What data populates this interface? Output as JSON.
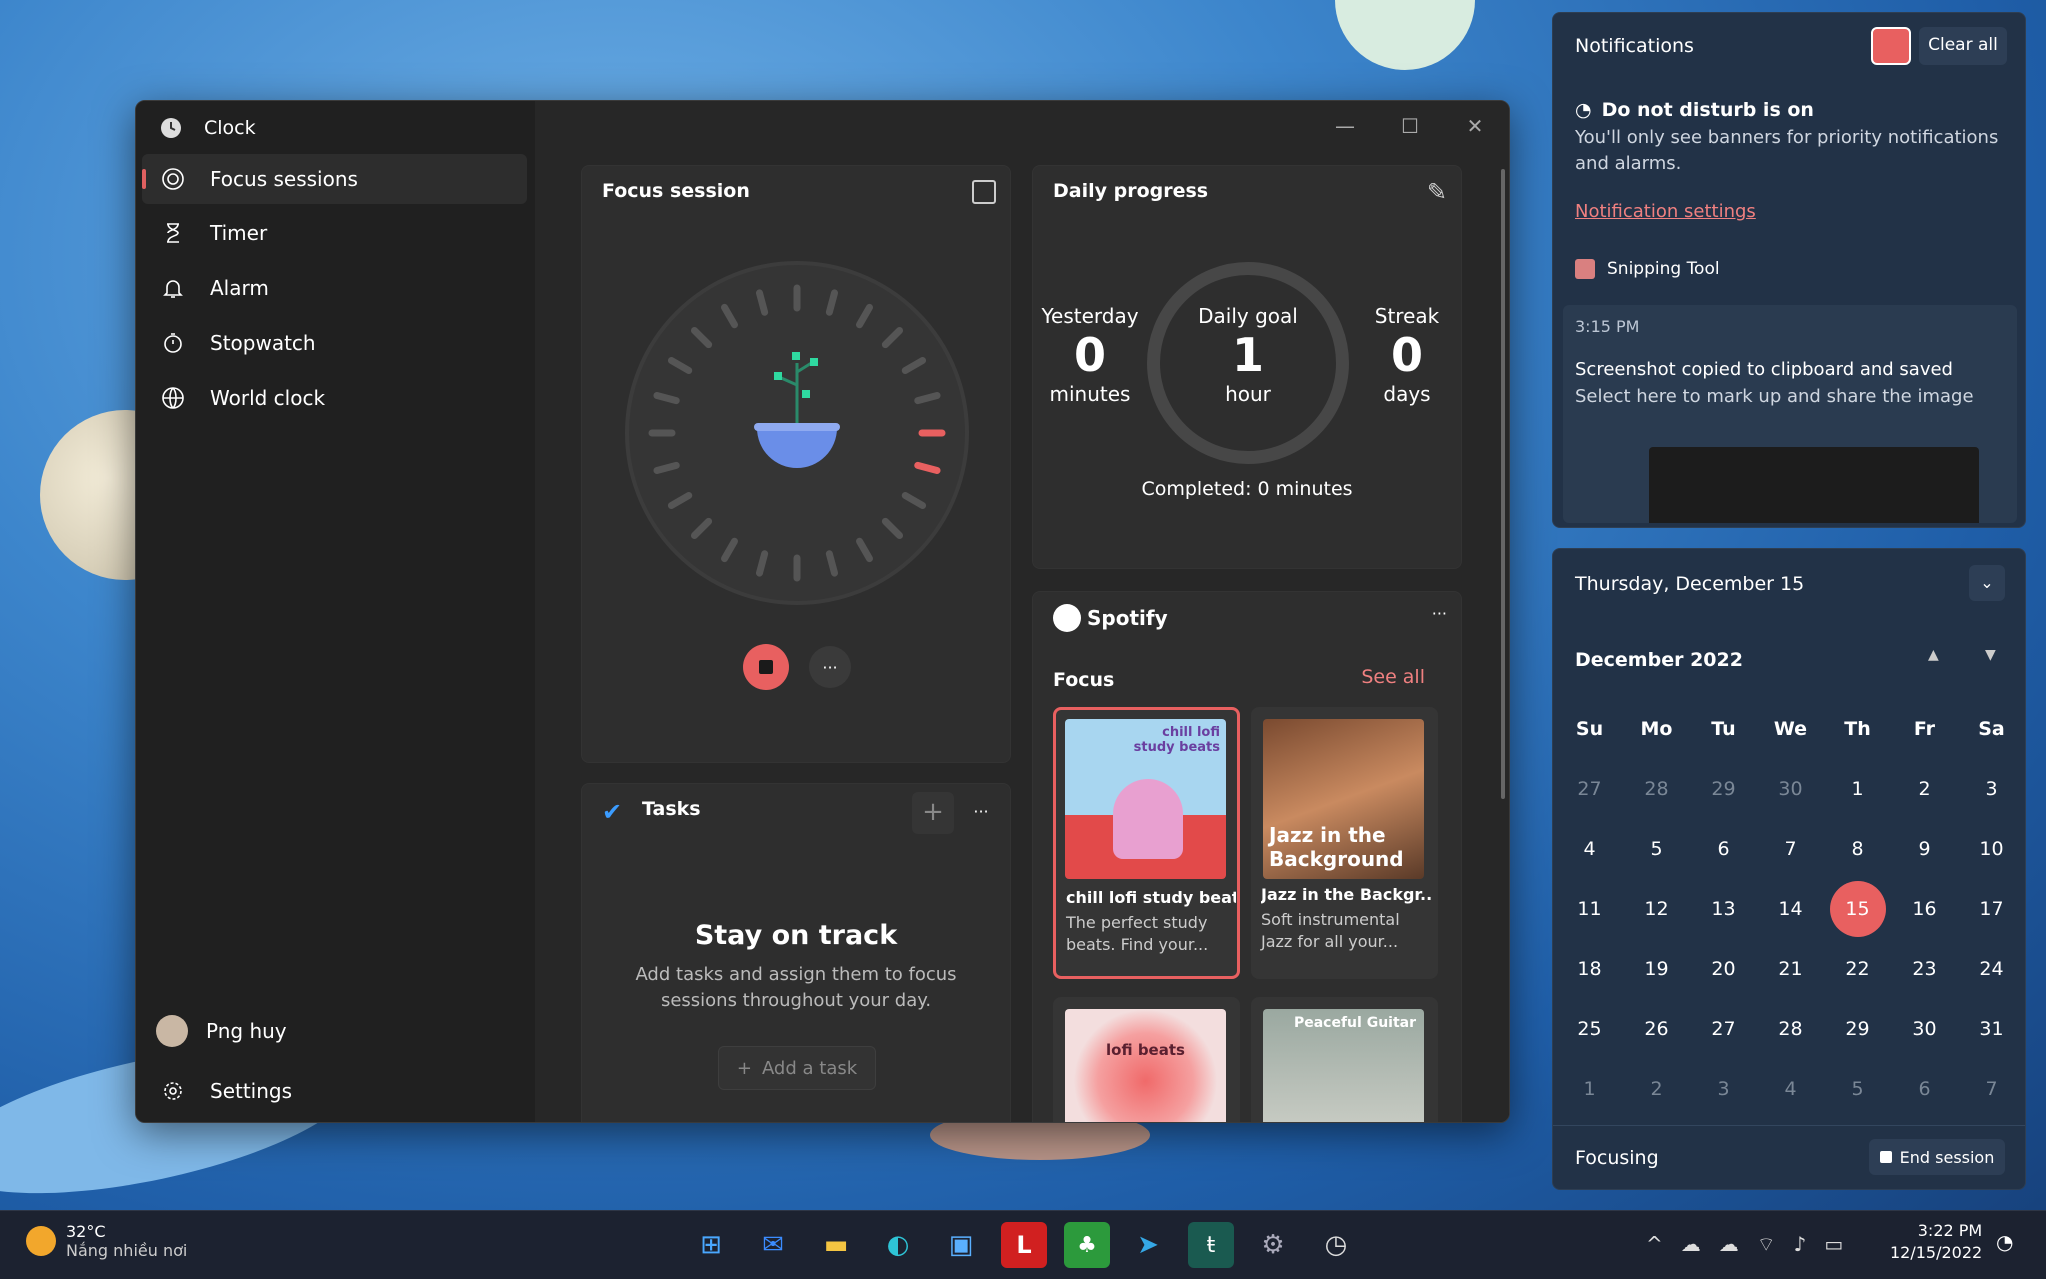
{
  "app": {
    "title": "Clock"
  },
  "nav": [
    {
      "label": "Focus sessions",
      "icon": "focus-icon"
    },
    {
      "label": "Timer",
      "icon": "hourglass-icon"
    },
    {
      "label": "Alarm",
      "icon": "bell-icon"
    },
    {
      "label": "Stopwatch",
      "icon": "stopwatch-icon"
    },
    {
      "label": "World clock",
      "icon": "globe-icon"
    }
  ],
  "user": {
    "name": "Png huy"
  },
  "settings": {
    "label": "Settings"
  },
  "focus": {
    "title": "Focus session"
  },
  "progress": {
    "title": "Daily progress",
    "yesterday_label": "Yesterday",
    "yesterday_value": "0",
    "yesterday_unit": "minutes",
    "goal_label": "Daily goal",
    "goal_value": "1",
    "goal_unit": "hour",
    "streak_label": "Streak",
    "streak_value": "0",
    "streak_unit": "days",
    "completed": "Completed: 0 minutes"
  },
  "tasks": {
    "title": "Tasks",
    "heading": "Stay on track",
    "body": "Add tasks and assign them to focus sessions throughout your day.",
    "add": "Add a task"
  },
  "spotify": {
    "logo": "Spotify",
    "section": "Focus",
    "see_all": "See all",
    "tiles": [
      {
        "title": "chill lofi study beats",
        "desc": "The perfect study beats. Find your...",
        "art": "chill lofi study beats"
      },
      {
        "title": "Jazz in the Backgr...",
        "desc": "Soft instrumental Jazz for all your...",
        "art": "Jazz in the Background"
      },
      {
        "title": "",
        "desc": "",
        "art": "lofi beats"
      },
      {
        "title": "",
        "desc": "",
        "art": "Peaceful Guitar"
      }
    ]
  },
  "notifications": {
    "title": "Notifications",
    "clear": "Clear all",
    "dnd_title": "Do not disturb is on",
    "dnd_body": "You'll only see banners for priority notifications and alarms.",
    "settings_link": "Notification settings",
    "app": "Snipping Tool",
    "time": "3:15 PM",
    "msg_title": "Screenshot copied to clipboard and saved",
    "msg_body": "Select here to mark up and share the image"
  },
  "calendar": {
    "date": "Thursday, December 15",
    "month": "December 2022",
    "days": [
      "Su",
      "Mo",
      "Tu",
      "We",
      "Th",
      "Fr",
      "Sa"
    ],
    "weeks": [
      [
        "27",
        "28",
        "29",
        "30",
        "1",
        "2",
        "3"
      ],
      [
        "4",
        "5",
        "6",
        "7",
        "8",
        "9",
        "10"
      ],
      [
        "11",
        "12",
        "13",
        "14",
        "15",
        "16",
        "17"
      ],
      [
        "18",
        "19",
        "20",
        "21",
        "22",
        "23",
        "24"
      ],
      [
        "25",
        "26",
        "27",
        "28",
        "29",
        "30",
        "31"
      ],
      [
        "1",
        "2",
        "3",
        "4",
        "5",
        "6",
        "7"
      ]
    ],
    "today": "15",
    "focus": "Focusing",
    "end": "End session"
  },
  "taskbar": {
    "temp": "32°C",
    "weather": "Nắng nhiều nơi",
    "time": "3:22 PM",
    "date": "12/15/2022"
  },
  "colors": {
    "accent": "#e86060",
    "panel": "#223247"
  }
}
